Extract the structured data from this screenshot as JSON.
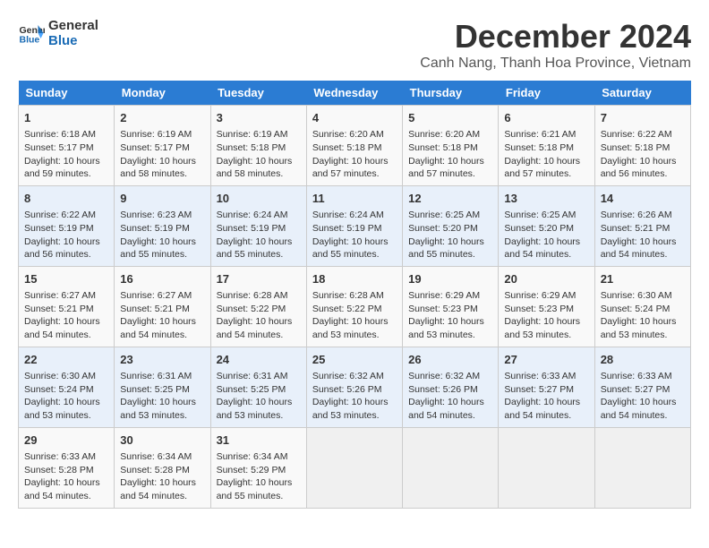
{
  "logo": {
    "line1": "General",
    "line2": "Blue"
  },
  "title": "December 2024",
  "location": "Canh Nang, Thanh Hoa Province, Vietnam",
  "days_of_week": [
    "Sunday",
    "Monday",
    "Tuesday",
    "Wednesday",
    "Thursday",
    "Friday",
    "Saturday"
  ],
  "weeks": [
    [
      {
        "day": "1",
        "info": "Sunrise: 6:18 AM\nSunset: 5:17 PM\nDaylight: 10 hours\nand 59 minutes."
      },
      {
        "day": "2",
        "info": "Sunrise: 6:19 AM\nSunset: 5:17 PM\nDaylight: 10 hours\nand 58 minutes."
      },
      {
        "day": "3",
        "info": "Sunrise: 6:19 AM\nSunset: 5:18 PM\nDaylight: 10 hours\nand 58 minutes."
      },
      {
        "day": "4",
        "info": "Sunrise: 6:20 AM\nSunset: 5:18 PM\nDaylight: 10 hours\nand 57 minutes."
      },
      {
        "day": "5",
        "info": "Sunrise: 6:20 AM\nSunset: 5:18 PM\nDaylight: 10 hours\nand 57 minutes."
      },
      {
        "day": "6",
        "info": "Sunrise: 6:21 AM\nSunset: 5:18 PM\nDaylight: 10 hours\nand 57 minutes."
      },
      {
        "day": "7",
        "info": "Sunrise: 6:22 AM\nSunset: 5:18 PM\nDaylight: 10 hours\nand 56 minutes."
      }
    ],
    [
      {
        "day": "8",
        "info": "Sunrise: 6:22 AM\nSunset: 5:19 PM\nDaylight: 10 hours\nand 56 minutes."
      },
      {
        "day": "9",
        "info": "Sunrise: 6:23 AM\nSunset: 5:19 PM\nDaylight: 10 hours\nand 55 minutes."
      },
      {
        "day": "10",
        "info": "Sunrise: 6:24 AM\nSunset: 5:19 PM\nDaylight: 10 hours\nand 55 minutes."
      },
      {
        "day": "11",
        "info": "Sunrise: 6:24 AM\nSunset: 5:19 PM\nDaylight: 10 hours\nand 55 minutes."
      },
      {
        "day": "12",
        "info": "Sunrise: 6:25 AM\nSunset: 5:20 PM\nDaylight: 10 hours\nand 55 minutes."
      },
      {
        "day": "13",
        "info": "Sunrise: 6:25 AM\nSunset: 5:20 PM\nDaylight: 10 hours\nand 54 minutes."
      },
      {
        "day": "14",
        "info": "Sunrise: 6:26 AM\nSunset: 5:21 PM\nDaylight: 10 hours\nand 54 minutes."
      }
    ],
    [
      {
        "day": "15",
        "info": "Sunrise: 6:27 AM\nSunset: 5:21 PM\nDaylight: 10 hours\nand 54 minutes."
      },
      {
        "day": "16",
        "info": "Sunrise: 6:27 AM\nSunset: 5:21 PM\nDaylight: 10 hours\nand 54 minutes."
      },
      {
        "day": "17",
        "info": "Sunrise: 6:28 AM\nSunset: 5:22 PM\nDaylight: 10 hours\nand 54 minutes."
      },
      {
        "day": "18",
        "info": "Sunrise: 6:28 AM\nSunset: 5:22 PM\nDaylight: 10 hours\nand 53 minutes."
      },
      {
        "day": "19",
        "info": "Sunrise: 6:29 AM\nSunset: 5:23 PM\nDaylight: 10 hours\nand 53 minutes."
      },
      {
        "day": "20",
        "info": "Sunrise: 6:29 AM\nSunset: 5:23 PM\nDaylight: 10 hours\nand 53 minutes."
      },
      {
        "day": "21",
        "info": "Sunrise: 6:30 AM\nSunset: 5:24 PM\nDaylight: 10 hours\nand 53 minutes."
      }
    ],
    [
      {
        "day": "22",
        "info": "Sunrise: 6:30 AM\nSunset: 5:24 PM\nDaylight: 10 hours\nand 53 minutes."
      },
      {
        "day": "23",
        "info": "Sunrise: 6:31 AM\nSunset: 5:25 PM\nDaylight: 10 hours\nand 53 minutes."
      },
      {
        "day": "24",
        "info": "Sunrise: 6:31 AM\nSunset: 5:25 PM\nDaylight: 10 hours\nand 53 minutes."
      },
      {
        "day": "25",
        "info": "Sunrise: 6:32 AM\nSunset: 5:26 PM\nDaylight: 10 hours\nand 53 minutes."
      },
      {
        "day": "26",
        "info": "Sunrise: 6:32 AM\nSunset: 5:26 PM\nDaylight: 10 hours\nand 54 minutes."
      },
      {
        "day": "27",
        "info": "Sunrise: 6:33 AM\nSunset: 5:27 PM\nDaylight: 10 hours\nand 54 minutes."
      },
      {
        "day": "28",
        "info": "Sunrise: 6:33 AM\nSunset: 5:27 PM\nDaylight: 10 hours\nand 54 minutes."
      }
    ],
    [
      {
        "day": "29",
        "info": "Sunrise: 6:33 AM\nSunset: 5:28 PM\nDaylight: 10 hours\nand 54 minutes."
      },
      {
        "day": "30",
        "info": "Sunrise: 6:34 AM\nSunset: 5:28 PM\nDaylight: 10 hours\nand 54 minutes."
      },
      {
        "day": "31",
        "info": "Sunrise: 6:34 AM\nSunset: 5:29 PM\nDaylight: 10 hours\nand 55 minutes."
      },
      {
        "day": "",
        "info": ""
      },
      {
        "day": "",
        "info": ""
      },
      {
        "day": "",
        "info": ""
      },
      {
        "day": "",
        "info": ""
      }
    ]
  ]
}
